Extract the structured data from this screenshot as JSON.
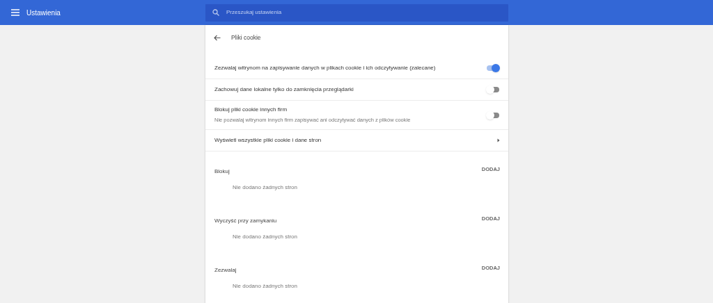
{
  "header": {
    "title": "Ustawienia"
  },
  "search": {
    "placeholder": "Przeszukaj ustawienia"
  },
  "page": {
    "title": "Pliki cookie"
  },
  "settings": [
    {
      "kind": "toggle",
      "label": "Zezwalaj witrynom na zapisywanie danych w plikach cookie i ich odczytywanie (zalecane)",
      "on": true
    },
    {
      "kind": "toggle",
      "label": "Zachowuj dane lokalne tylko do zamknięcia przeglądarki",
      "on": false
    },
    {
      "kind": "toggle",
      "label": "Blokuj pliki cookie innych firm",
      "sublabel": "Nie pozwalaj witrynom innych firm zapisywać ani odczytywać danych z plików cookie",
      "on": false
    },
    {
      "kind": "link",
      "label": "Wyświetl wszystkie pliki cookie i dane stron"
    }
  ],
  "sections": [
    {
      "title": "Blokuj",
      "action": "DODAJ",
      "empty": "Nie dodano żadnych stron"
    },
    {
      "title": "Wyczyść przy zamykaniu",
      "action": "DODAJ",
      "empty": "Nie dodano żadnych stron"
    },
    {
      "title": "Zezwalaj",
      "action": "DODAJ",
      "empty": "Nie dodano żadnych stron"
    }
  ]
}
